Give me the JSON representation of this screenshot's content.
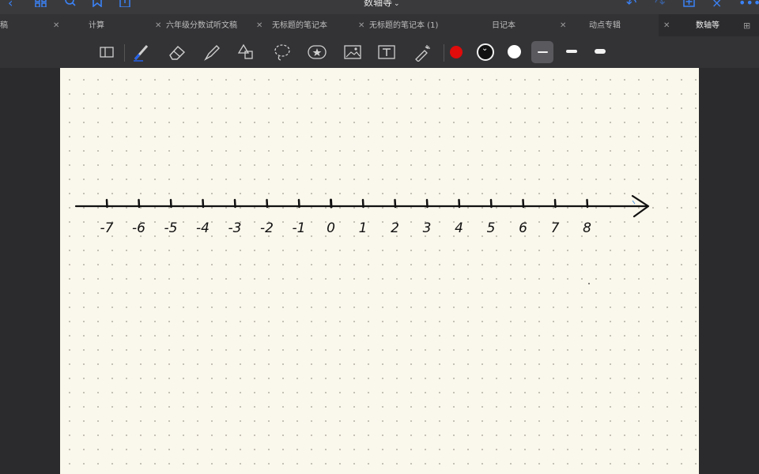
{
  "header": {
    "title": "数轴等",
    "icons": [
      "back-icon",
      "grid-icon",
      "search-icon",
      "bookmark-icon",
      "share-icon",
      "undo-icon",
      "redo-icon",
      "add-page-icon",
      "close-icon",
      "more-icon"
    ]
  },
  "tabs": [
    {
      "label": "稿",
      "active": false
    },
    {
      "label": "计算",
      "active": false
    },
    {
      "label": "六年级分数试听文稿",
      "active": false
    },
    {
      "label": "无标题的笔记本",
      "active": false
    },
    {
      "label": "无标题的笔记本 (1)",
      "active": false
    },
    {
      "label": "日记本",
      "active": false
    },
    {
      "label": "动点专辑",
      "active": false
    },
    {
      "label": "数轴等",
      "active": true
    }
  ],
  "toolbar": {
    "tools": [
      "page-layout",
      "pen",
      "eraser",
      "highlighter",
      "shapes",
      "lasso",
      "sticker",
      "image",
      "text",
      "laser-pointer"
    ],
    "selected_tool": "pen",
    "colors": {
      "red": "#e00b0b",
      "black": "#111111",
      "white": "#ffffff"
    },
    "selected_color": "black",
    "thickness_options": 3,
    "selected_thickness": 1
  },
  "number_line": {
    "ticks": [
      "-7",
      "-6",
      "-5",
      "-4",
      "-3",
      "-2",
      "-1",
      "0",
      "1",
      "2",
      "3",
      "4",
      "5",
      "6",
      "7",
      "8"
    ]
  }
}
